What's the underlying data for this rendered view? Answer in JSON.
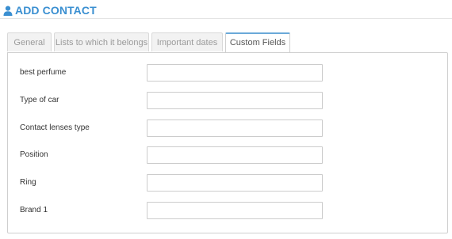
{
  "header": {
    "title": "ADD CONTACT",
    "icon": "user-icon",
    "accent": "#3a8fd1"
  },
  "tabs": [
    {
      "label": "General",
      "active": false
    },
    {
      "label": "Lists to which it belongs",
      "active": false
    },
    {
      "label": "Important dates",
      "active": false
    },
    {
      "label": "Custom Fields",
      "active": true
    }
  ],
  "custom_fields": [
    {
      "label": "best perfume",
      "value": ""
    },
    {
      "label": "Type of car",
      "value": ""
    },
    {
      "label": "Contact lenses type",
      "value": ""
    },
    {
      "label": "Position",
      "value": ""
    },
    {
      "label": "Ring",
      "value": ""
    },
    {
      "label": "Brand 1",
      "value": ""
    }
  ]
}
